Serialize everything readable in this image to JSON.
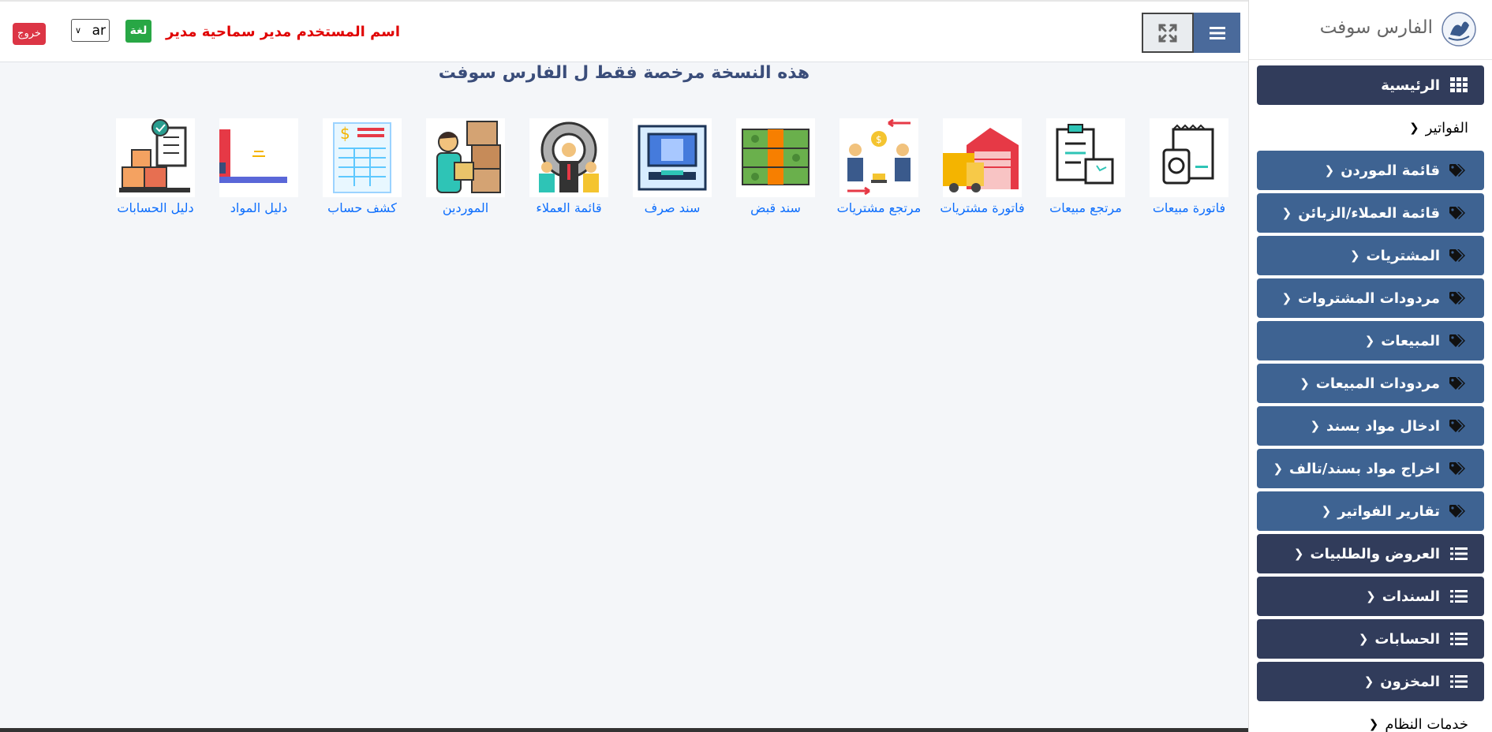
{
  "header": {
    "logout_label": "خروج",
    "lang_value": "ar",
    "lang_label": "لغة",
    "user_label": "اسم المستخدم مدير",
    "permission_label": "سماحية مدير"
  },
  "notice": "هذه النسخة مرخصة فقط ل الفارس سوفت",
  "shortcuts": [
    {
      "label": "فاتورة مبيعات",
      "icon": "sales-invoice-icon"
    },
    {
      "label": "مرتجع مبيعات",
      "icon": "sales-return-icon"
    },
    {
      "label": "فاتورة مشتريات",
      "icon": "purchase-invoice-icon"
    },
    {
      "label": "مرتجع مشتريات",
      "icon": "purchase-return-icon"
    },
    {
      "label": "سند قبض",
      "icon": "receipt-voucher-icon"
    },
    {
      "label": "سند صرف",
      "icon": "payment-voucher-icon"
    },
    {
      "label": "قائمة العملاء",
      "icon": "customers-icon"
    },
    {
      "label": "الموردين",
      "icon": "suppliers-icon"
    },
    {
      "label": "كشف حساب",
      "icon": "account-statement-icon"
    },
    {
      "label": "دليل المواد",
      "icon": "materials-guide-icon"
    },
    {
      "label": "دليل الحسابات",
      "icon": "accounts-guide-icon"
    }
  ],
  "sidebar": {
    "brand": "الفارس سوفت",
    "items": [
      {
        "label": "الرئيسية",
        "style": "dark",
        "icon": "grid-icon",
        "chevron": false
      },
      {
        "label": "الفواتير",
        "style": "active",
        "icon": "",
        "chevron": true
      },
      {
        "label": "قائمة الموردن",
        "style": "sub",
        "icon": "tag-icon",
        "chevron": true
      },
      {
        "label": "قائمة العملاء/الزبائن",
        "style": "sub",
        "icon": "tag-icon",
        "chevron": true
      },
      {
        "label": "المشتريات",
        "style": "sub",
        "icon": "tag-icon",
        "chevron": true
      },
      {
        "label": "مردودات المشتروات",
        "style": "sub",
        "icon": "tag-icon",
        "chevron": true
      },
      {
        "label": "المبيعات",
        "style": "sub",
        "icon": "tag-icon",
        "chevron": true
      },
      {
        "label": "مردودات المبيعات",
        "style": "sub",
        "icon": "tag-icon",
        "chevron": true
      },
      {
        "label": "ادخال مواد بسند",
        "style": "sub",
        "icon": "tag-icon",
        "chevron": true
      },
      {
        "label": "اخراج مواد بسند/تالف",
        "style": "sub",
        "icon": "tag-icon",
        "chevron": true
      },
      {
        "label": "تقارير الفواتير",
        "style": "sub",
        "icon": "tag-icon",
        "chevron": true
      },
      {
        "label": "العروض والطلبيات",
        "style": "dark",
        "icon": "list-icon",
        "chevron": true
      },
      {
        "label": "السندات",
        "style": "dark",
        "icon": "list-icon",
        "chevron": true
      },
      {
        "label": "الحسابات",
        "style": "dark",
        "icon": "list-icon",
        "chevron": true
      },
      {
        "label": "المخزون",
        "style": "dark",
        "icon": "list-icon",
        "chevron": true
      },
      {
        "label": "خدمات النظام",
        "style": "active",
        "icon": "",
        "chevron": true
      }
    ]
  }
}
